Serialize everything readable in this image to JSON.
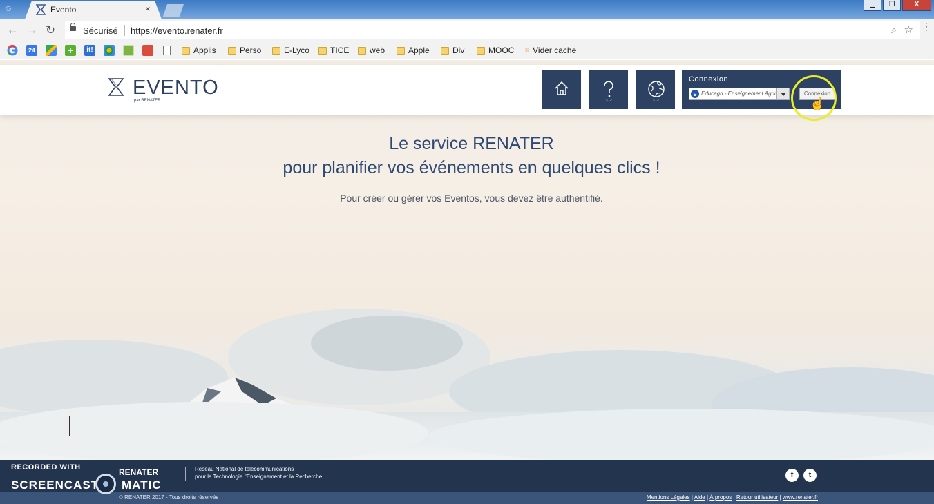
{
  "browser": {
    "tab_title": "Evento",
    "tab_close": "×",
    "secure_label": "Sécurisé",
    "url": "https://evento.renater.fr",
    "bookmarks": [
      "Applis",
      "Perso",
      "E-Lyco",
      "TICE",
      "web",
      "Apple",
      "Div",
      "MOOC",
      "Vider cache"
    ],
    "bookmark_icons": [
      "google-icon",
      "calendar-24-icon",
      "maps-icon",
      "plus-icon",
      "it-icon",
      "puzzle-icon",
      "photo-icon",
      "todoist-icon",
      "page-icon"
    ],
    "window_controls": {
      "minimize": "▁",
      "maximize": "❐",
      "close": "X"
    }
  },
  "site": {
    "logo_text": "EVENTO",
    "logo_sub": "par RENATER",
    "nav": [
      {
        "name": "home",
        "icon": "home-icon"
      },
      {
        "name": "help",
        "icon": "question-icon"
      },
      {
        "name": "language",
        "icon": "globe-icon"
      }
    ],
    "login": {
      "title": "Connexion",
      "idp_selected": "Educagri - Enseignement Agricole",
      "button": "Connexion"
    },
    "hero": {
      "line1": "Le service RENATER",
      "line2": "pour planifier vos événements en quelques clics !",
      "subtitle": "Pour créer ou gérer vos Eventos, vous devez être authentifié."
    },
    "footer": {
      "renater_logo": "RENATER",
      "desc_line1": "Réseau National de télécommunications",
      "desc_line2": "pour la Technologie l'Enseignement et la Recherche.",
      "copyright": "© RENATER 2017 - Tous droits réservés",
      "links": [
        "Mentions Légales",
        "Aide",
        "À propos",
        "Retour utilisateur",
        "www.renater.fr"
      ],
      "social": [
        "f",
        "t"
      ]
    }
  },
  "watermark": {
    "line1": "RECORDED WITH",
    "line2": "SCREENCAST",
    "line3": "MATIC"
  }
}
